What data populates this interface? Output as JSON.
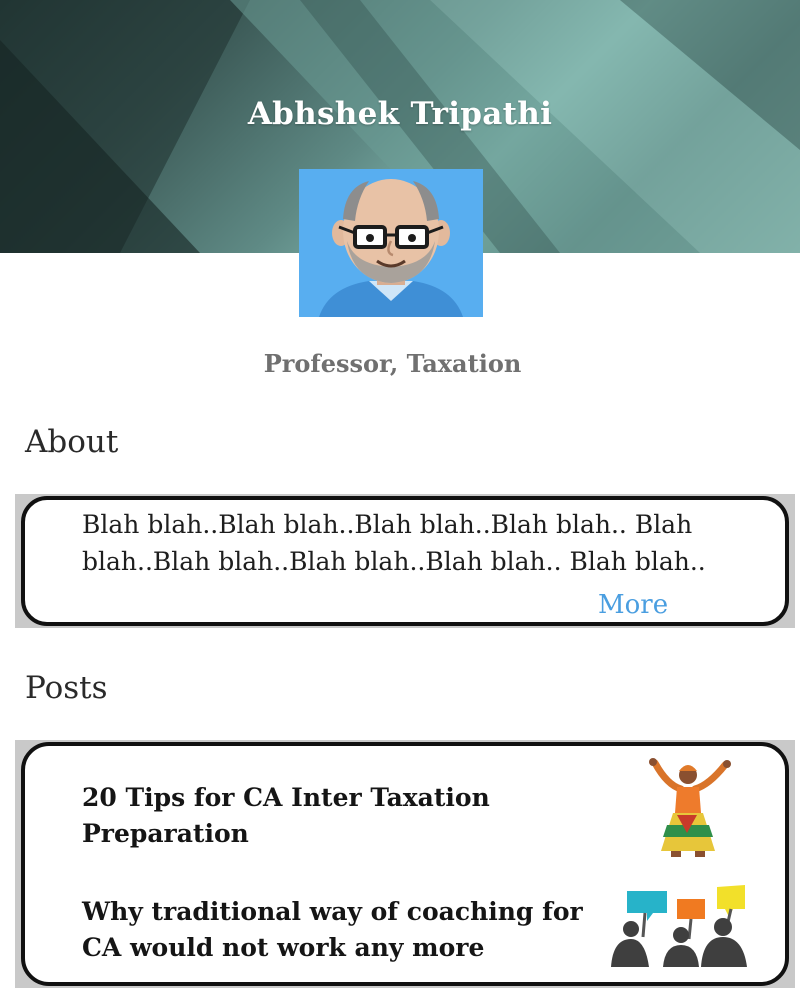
{
  "profile": {
    "name": "Abhshek Tripathi",
    "role": "Professor, Taxation"
  },
  "about": {
    "heading": "About",
    "text": "Blah blah..Blah blah..Blah blah..Blah blah.. Blah blah..Blah blah..Blah blah..Blah blah.. Blah blah..",
    "more_label": "More"
  },
  "posts": {
    "heading": "Posts",
    "items": [
      {
        "title": "20 Tips for CA Inter Taxation Preparation",
        "icon": "dancing-woman-icon"
      },
      {
        "title": "Why traditional way of coaching for CA would not work any more",
        "icon": "protest-signs-icon"
      }
    ]
  },
  "colors": {
    "banner": "#4f7672",
    "avatar_background": "#58aef0",
    "more_link": "#4a9ee0",
    "role_text": "#707070"
  }
}
